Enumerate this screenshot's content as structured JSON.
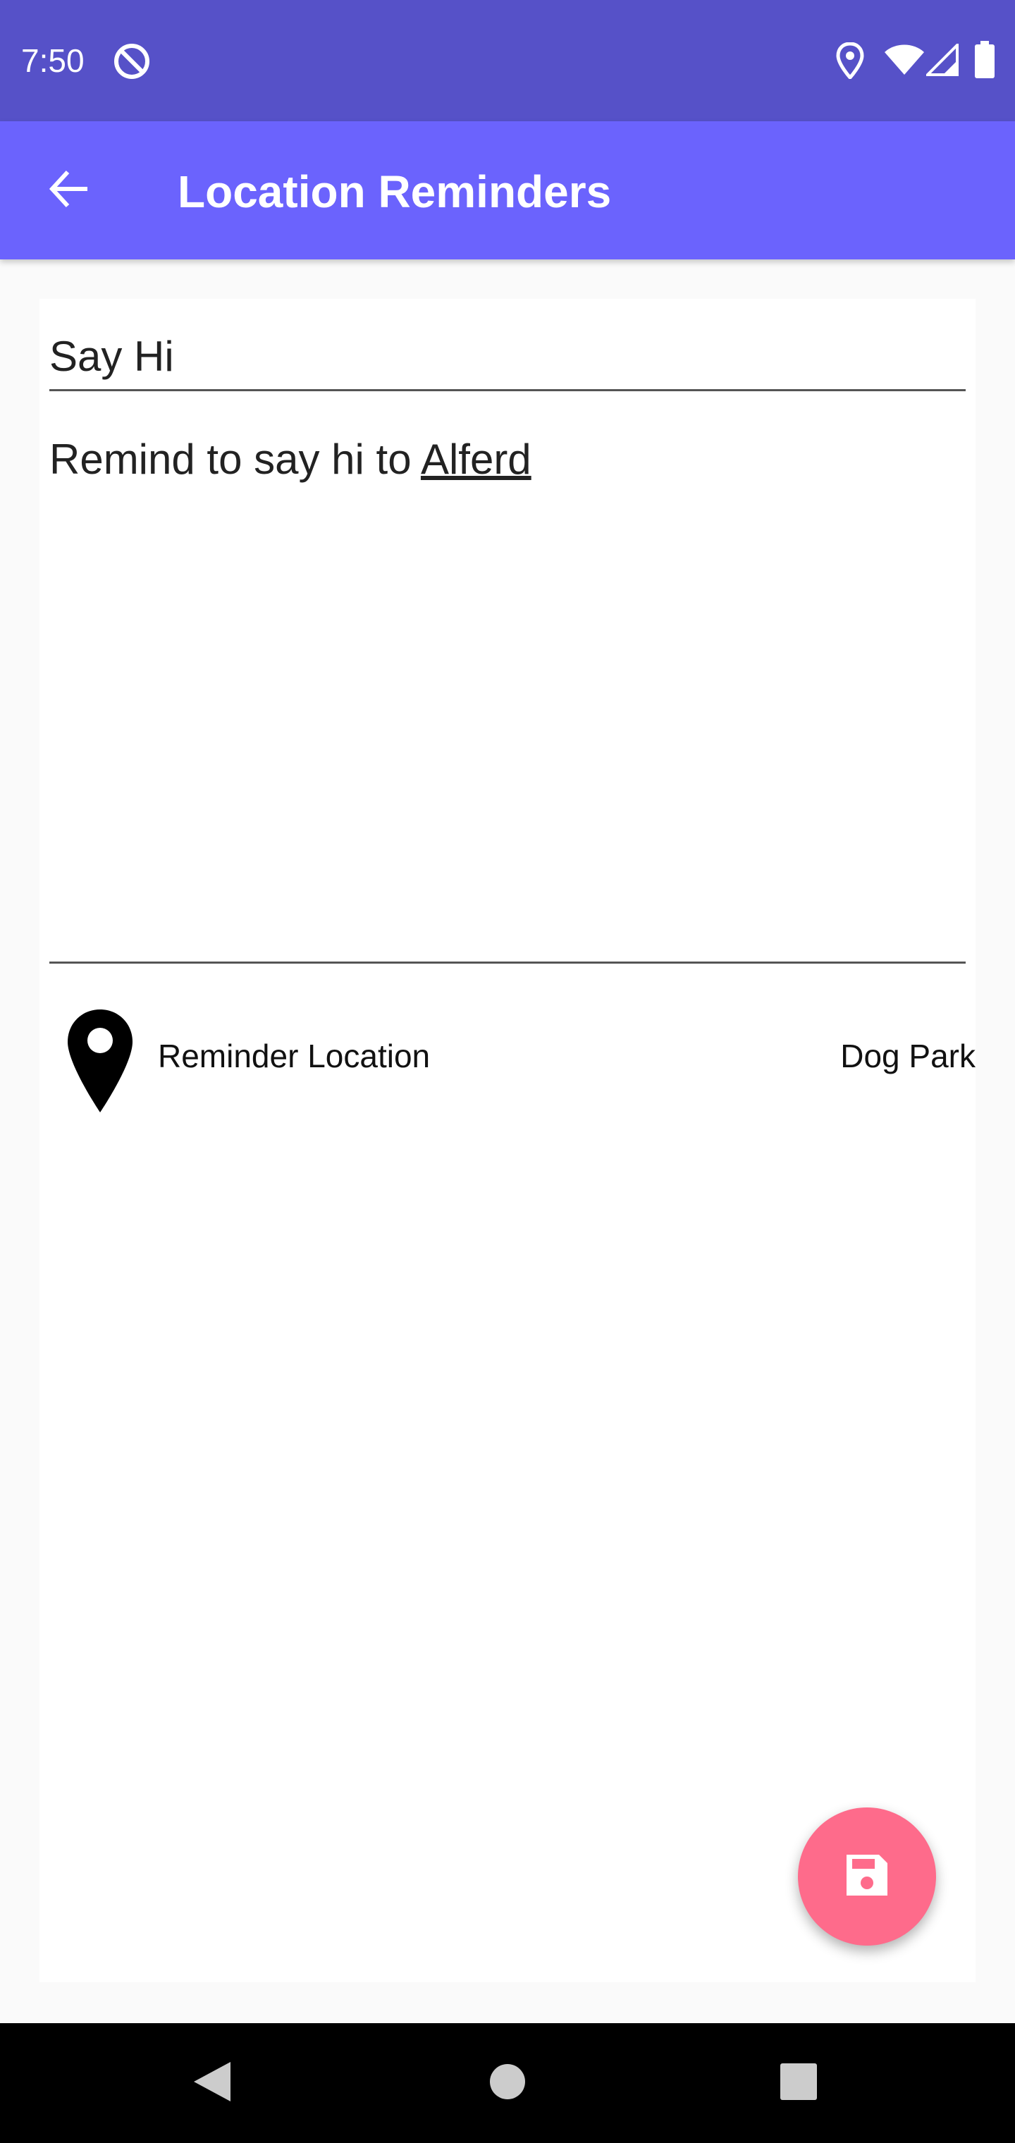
{
  "status_bar": {
    "time": "7:50",
    "icons": [
      "sync-icon",
      "location-icon",
      "wifi-icon",
      "signal-icon",
      "battery-icon"
    ]
  },
  "app_bar": {
    "title": "Location Reminders",
    "back_icon": "arrow-back-icon"
  },
  "form": {
    "title_value": "Say Hi",
    "description_prefix": "Remind to say hi to ",
    "description_flagged_word": "Alferd",
    "location_label": "Reminder Location",
    "location_value": "Dog Park"
  },
  "fab": {
    "icon": "save-icon",
    "color": "#fe6b8b"
  },
  "nav_bar": {
    "icons": [
      "back-triangle-icon",
      "home-circle-icon",
      "recents-square-icon"
    ]
  },
  "colors": {
    "status_bar": "#5651c8",
    "app_bar": "#6b63fd",
    "fab": "#fe6b8b"
  }
}
